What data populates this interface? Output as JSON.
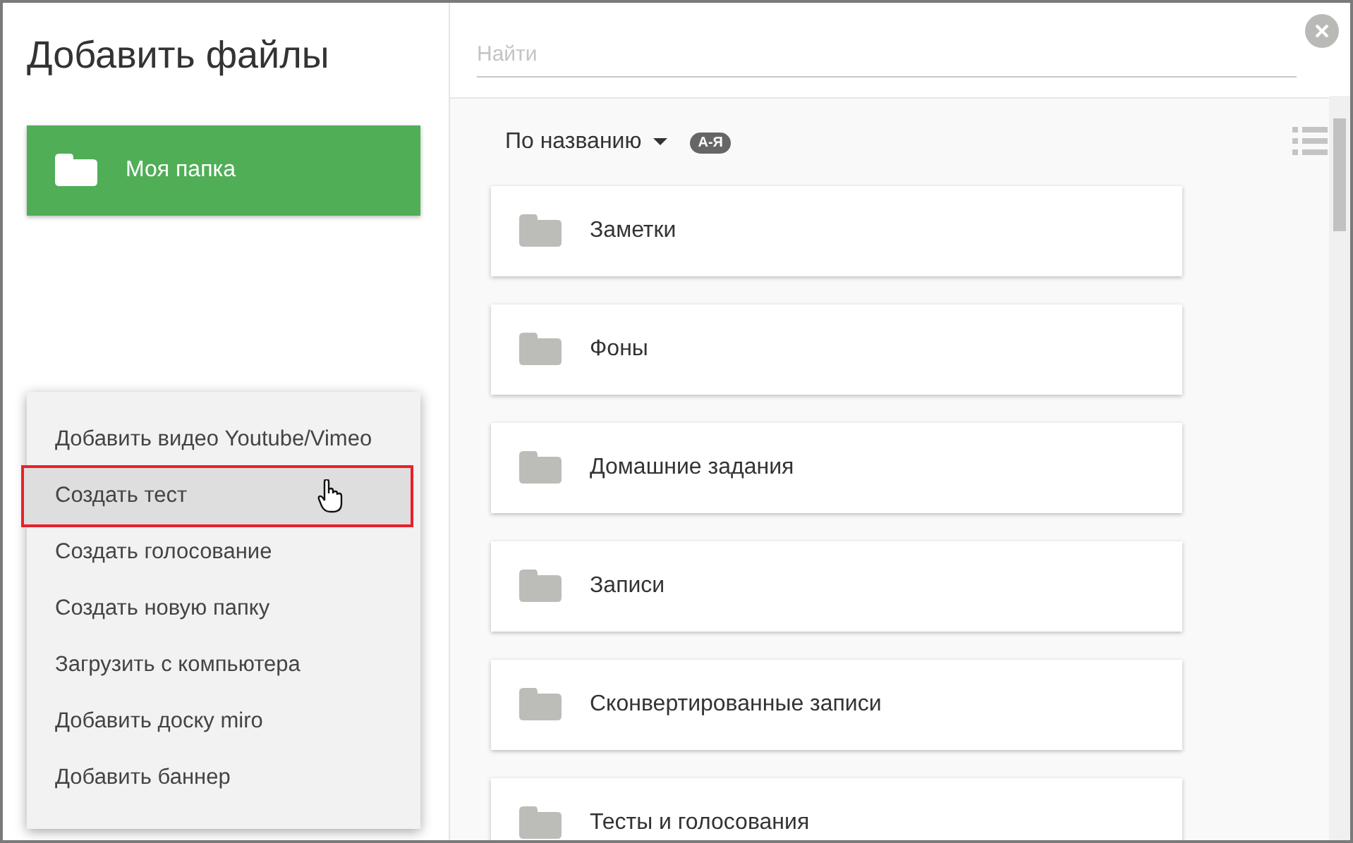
{
  "title": "Добавить файлы",
  "my_folder": {
    "label": "Моя папка"
  },
  "menu": [
    {
      "label": "Добавить видео Youtube/Vimeo",
      "selected": false
    },
    {
      "label": "Создать тест",
      "selected": true
    },
    {
      "label": "Создать голосование",
      "selected": false
    },
    {
      "label": "Создать новую папку",
      "selected": false
    },
    {
      "label": "Загрузить с компьютера",
      "selected": false
    },
    {
      "label": "Добавить доску miro",
      "selected": false
    },
    {
      "label": "Добавить баннер",
      "selected": false
    }
  ],
  "search": {
    "placeholder": "Найти"
  },
  "sort": {
    "label": "По названию",
    "order": "А-Я"
  },
  "folders": [
    {
      "name": "Заметки"
    },
    {
      "name": "Фоны"
    },
    {
      "name": "Домашние задания"
    },
    {
      "name": "Записи"
    },
    {
      "name": "Сконвертированные записи"
    },
    {
      "name": "Тесты и голосования"
    }
  ]
}
